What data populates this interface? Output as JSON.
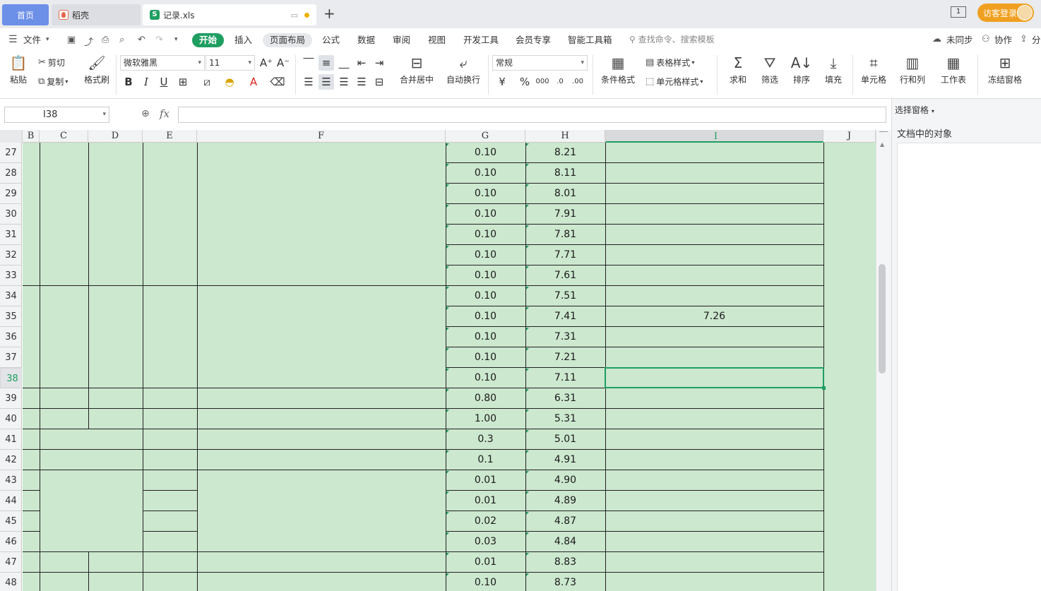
{
  "tabs": {
    "home": "首页",
    "tab1": "稻壳",
    "tab2": "记录.xls",
    "new_tab": "+",
    "login": "访客登录",
    "window_count": "1"
  },
  "menu": {
    "file": "文件",
    "items": [
      "开始",
      "插入",
      "页面布局",
      "公式",
      "数据",
      "审阅",
      "视图",
      "开发工具",
      "会员专享",
      "智能工具箱"
    ],
    "search": "查找命令、搜索模板",
    "sync": "未同步",
    "collab": "协作",
    "share": "分"
  },
  "ribbon": {
    "paste": "粘贴",
    "cut": "剪切",
    "copy": "复制",
    "format_painter": "格式刷",
    "font_name": "微软雅黑",
    "font_size": "11",
    "merge_center": "合并居中",
    "wrap_text": "自动换行",
    "number_format": "常规",
    "conditional_format": "条件格式",
    "table_style": "表格样式",
    "cell_style": "单元格样式",
    "sum": "求和",
    "filter": "筛选",
    "sort": "排序",
    "fill": "填充",
    "cell": "单元格",
    "row_col": "行和列",
    "worksheet": "工作表",
    "freeze": "冻结窗格"
  },
  "formula_bar": {
    "name_box": "I38",
    "fx": "fx",
    "content": ""
  },
  "pane": {
    "title": "选择窗格",
    "subtitle": "文档中的对象"
  },
  "columns": [
    "B",
    "C",
    "D",
    "E",
    "F",
    "G",
    "H",
    "I",
    "J"
  ],
  "rows": [
    {
      "num": "27",
      "g": "0.10",
      "h": "8.21",
      "i": ""
    },
    {
      "num": "28",
      "g": "0.10",
      "h": "8.11",
      "i": ""
    },
    {
      "num": "29",
      "g": "0.10",
      "h": "8.01",
      "i": ""
    },
    {
      "num": "30",
      "g": "0.10",
      "h": "7.91",
      "i": ""
    },
    {
      "num": "31",
      "g": "0.10",
      "h": "7.81",
      "i": ""
    },
    {
      "num": "32",
      "g": "0.10",
      "h": "7.71",
      "i": ""
    },
    {
      "num": "33",
      "g": "0.10",
      "h": "7.61",
      "i": ""
    },
    {
      "num": "34",
      "g": "0.10",
      "h": "7.51",
      "i": ""
    },
    {
      "num": "35",
      "g": "0.10",
      "h": "7.41",
      "i": "7.26"
    },
    {
      "num": "36",
      "g": "0.10",
      "h": "7.31",
      "i": ""
    },
    {
      "num": "37",
      "g": "0.10",
      "h": "7.21",
      "i": ""
    },
    {
      "num": "38",
      "g": "0.10",
      "h": "7.11",
      "i": ""
    },
    {
      "num": "39",
      "g": "0.80",
      "h": "6.31",
      "i": ""
    },
    {
      "num": "40",
      "g": "1.00",
      "h": "5.31",
      "i": ""
    },
    {
      "num": "41",
      "g": "0.3",
      "h": "5.01",
      "i": ""
    },
    {
      "num": "42",
      "g": "0.1",
      "h": "4.91",
      "i": ""
    },
    {
      "num": "43",
      "g": "0.01",
      "h": "4.90",
      "i": ""
    },
    {
      "num": "44",
      "g": "0.01",
      "h": "4.89",
      "i": ""
    },
    {
      "num": "45",
      "g": "0.02",
      "h": "4.87",
      "i": ""
    },
    {
      "num": "46",
      "g": "0.03",
      "h": "4.84",
      "i": ""
    },
    {
      "num": "47",
      "g": "0.01",
      "h": "8.83",
      "i": ""
    },
    {
      "num": "48",
      "g": "0.10",
      "h": "8.73",
      "i": ""
    }
  ],
  "selected_cell": {
    "column": "I",
    "row": "38"
  },
  "colors": {
    "accent": "#1f9e61",
    "cell_fill": "#cce8cf",
    "home_tab": "#6c8fe8",
    "login": "#f0a020"
  }
}
